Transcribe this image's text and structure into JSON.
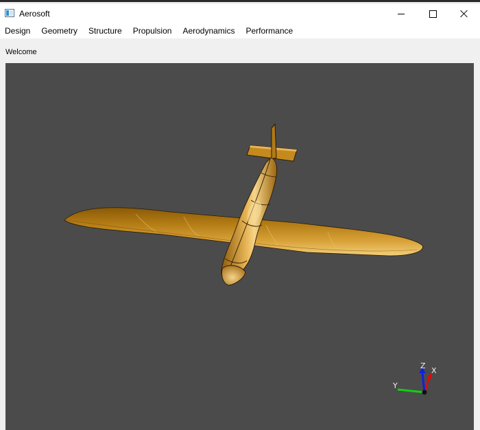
{
  "window": {
    "title": "Aerosoft",
    "controls": {
      "minimize": "minimize-icon",
      "maximize": "maximize-icon",
      "close": "close-icon"
    }
  },
  "menu": {
    "items": [
      "Design",
      "Geometry",
      "Structure",
      "Propulsion",
      "Aerodynamics",
      "Performance"
    ]
  },
  "status": {
    "text": "Welcome"
  },
  "viewport": {
    "background": "#4b4b4b",
    "model_color": "#c48a1e",
    "axes": {
      "x_label": "X",
      "y_label": "Y",
      "z_label": "Z",
      "x_color": "#d01010",
      "y_color": "#10d010",
      "z_color": "#1020e0"
    }
  }
}
